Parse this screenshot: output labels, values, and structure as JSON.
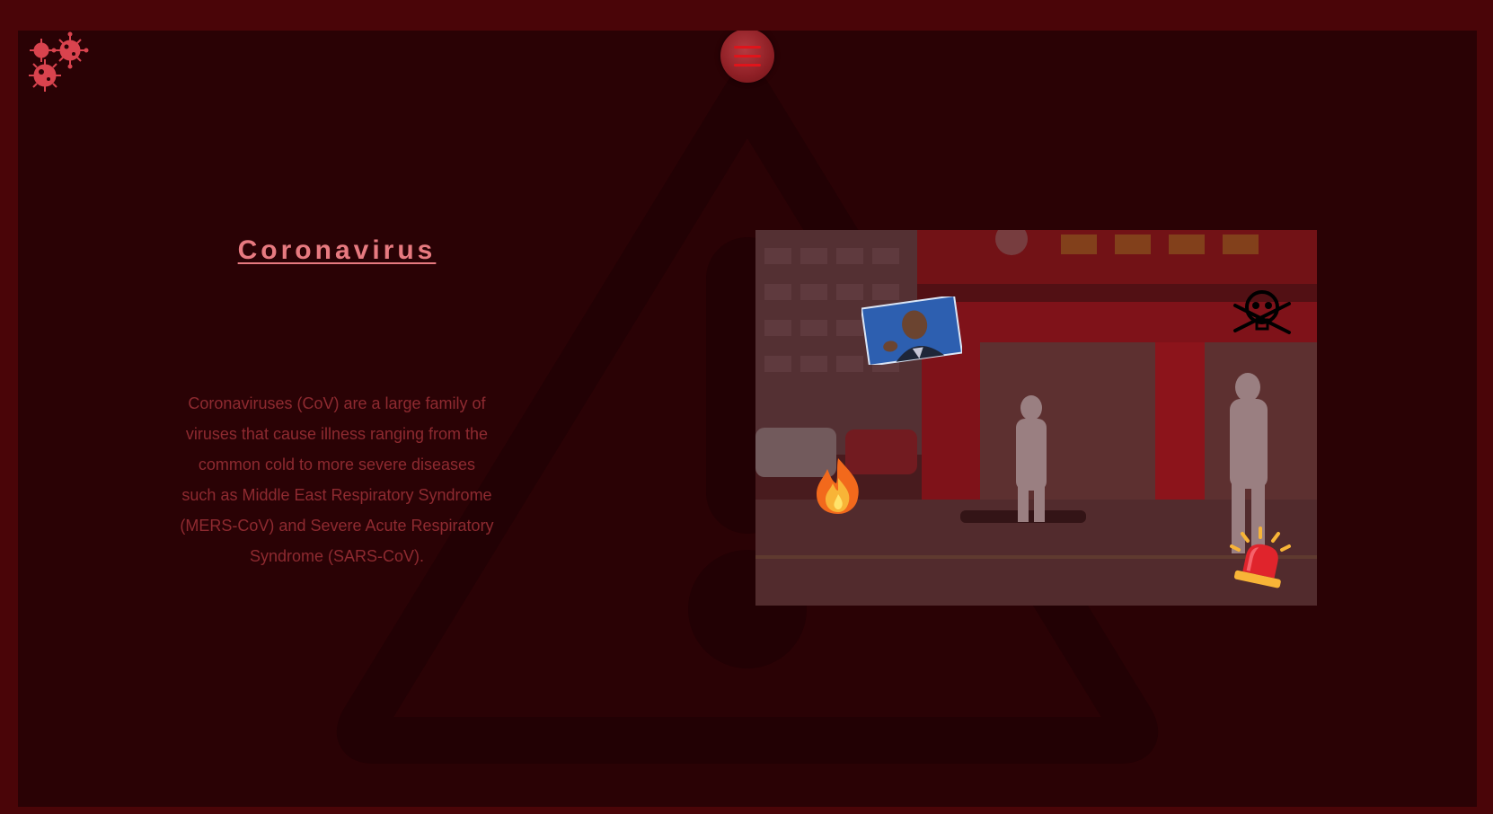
{
  "header": {
    "logo_icon": "virus-cluster-icon",
    "menu_icon": "hamburger-menu-icon"
  },
  "main": {
    "title": "Coronavirus",
    "description": "Coronaviruses (CoV) are a large family of viruses that cause illness ranging from the common cold to more severe diseases such as Middle East Respiratory Syndrome (MERS-CoV) and Severe Acute Respiratory Syndrome (SARS-CoV).",
    "background_icon": "warning-triangle-icon"
  },
  "photo": {
    "stickers": [
      "portrait-sticker",
      "skull-crossbones-icon",
      "fire-icon",
      "siren-icon"
    ]
  },
  "colors": {
    "page_border": "#4a0508",
    "panel_background": "#2a0205",
    "title": "#e77a80",
    "body_text": "#8e2a30",
    "menu_button": "#8e1f25"
  }
}
